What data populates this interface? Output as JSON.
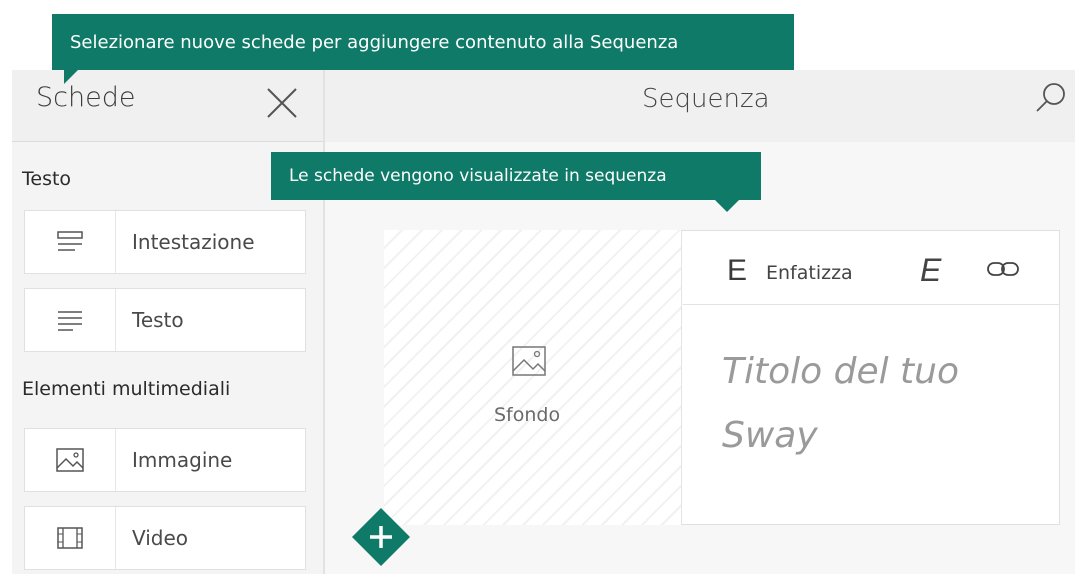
{
  "tooltips": {
    "cards_hint": "Selezionare nuove schede per aggiungere contenuto alla Sequenza",
    "storyline_hint": "Le schede vengono visualizzate in sequenza"
  },
  "sidebar": {
    "title": "Schede",
    "sections": [
      {
        "title": "Testo",
        "items": [
          {
            "label": "Intestazione",
            "icon": "heading-icon"
          },
          {
            "label": "Testo",
            "icon": "text-icon"
          }
        ]
      },
      {
        "title": "Elementi multimediali",
        "items": [
          {
            "label": "Immagine",
            "icon": "image-icon"
          },
          {
            "label": "Video",
            "icon": "video-icon"
          }
        ]
      }
    ]
  },
  "main": {
    "title": "Sequenza",
    "card": {
      "background_label": "Sfondo",
      "toolbar": {
        "emphasize_letter": "E",
        "emphasize_label": "Enfatizza",
        "italic_letter": "E"
      },
      "title_placeholder_line1": "Titolo del tuo",
      "title_placeholder_line2": "Sway"
    }
  },
  "colors": {
    "accent": "#0f7a68",
    "sidebar_bg": "#f4f4f4",
    "header_bg": "#f0f0f0"
  }
}
